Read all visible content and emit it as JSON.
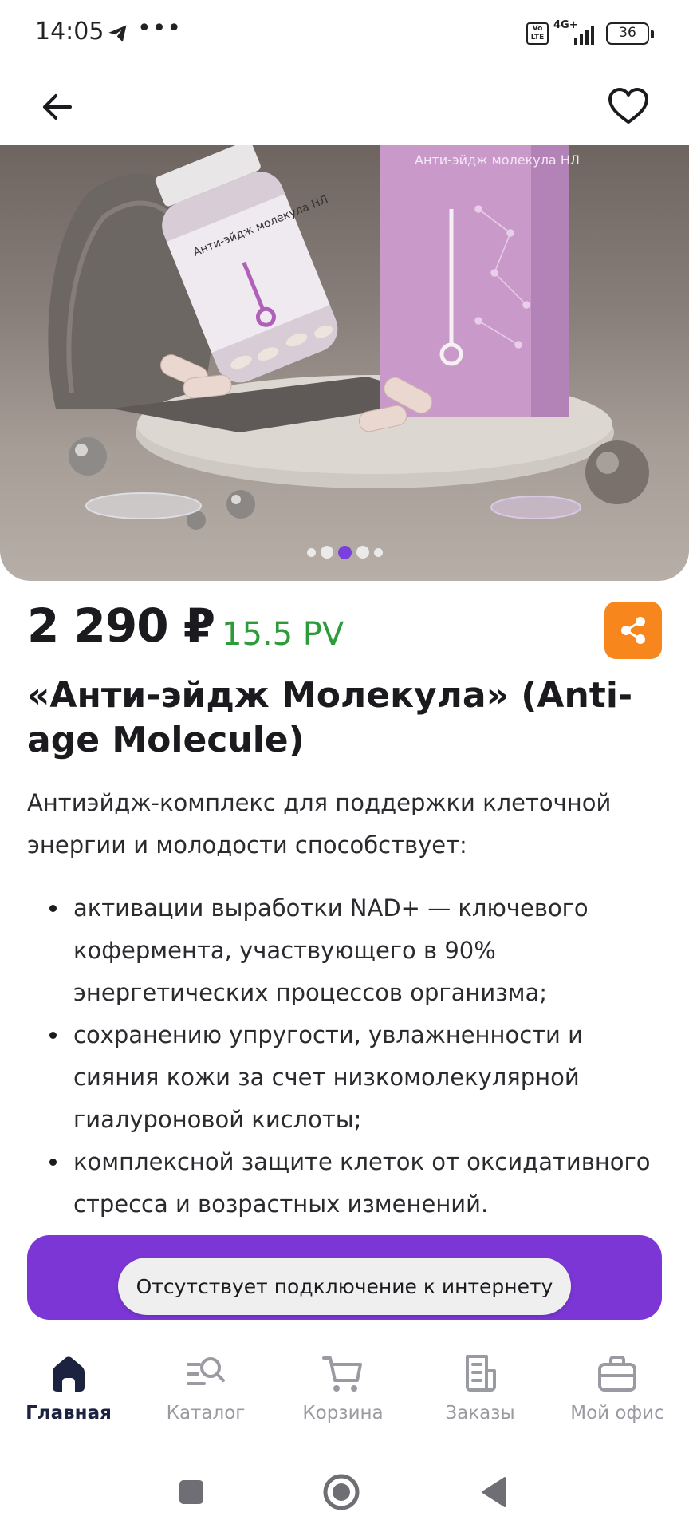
{
  "status_bar": {
    "time": "14:05",
    "more": "•••",
    "network": "4G+",
    "volte": "Vo LTE",
    "battery": "36"
  },
  "product": {
    "price": "2 290 ₽",
    "pv": "15.5 PV",
    "title": "«Анти-эйдж Молекула» (Anti-age Molecule)",
    "description": "Антиэйдж-комплекс для поддержки клеточной энергии и молодости способствует:",
    "benefits": [
      "активации выработки NAD+ — ключевого кофермента, участвующего в 90% энергетических процессов организма;",
      "сохранению упругости, увлажненности и сияния кожи за счет низкомолекулярной гиалуроновой кислоты;",
      "комплексной защите клеток от оксидативного стресса и возрастных изменений."
    ],
    "image": {
      "bottle_label": "Анти-эйдж молекула НЛ",
      "box_label": "Анти-эйдж молекула НЛ"
    },
    "gallery": {
      "slide_count": 5,
      "active_index": 2
    }
  },
  "toast": {
    "message": "Отсутствует подключение к интернету"
  },
  "bottom_nav": {
    "items": [
      {
        "label": "Главная",
        "icon": "home-icon",
        "active": true
      },
      {
        "label": "Каталог",
        "icon": "catalog-search-icon",
        "active": false
      },
      {
        "label": "Корзина",
        "icon": "cart-icon",
        "active": false
      },
      {
        "label": "Заказы",
        "icon": "orders-icon",
        "active": false
      },
      {
        "label": "Мой офис",
        "icon": "briefcase-icon",
        "active": false
      }
    ]
  },
  "colors": {
    "accent_purple": "#7c36d6",
    "pv_green": "#2e9b3a",
    "share_orange": "#f7861d",
    "nav_active": "#1c2340",
    "nav_inactive": "#9a9aa2"
  },
  "system_nav": {
    "icons": [
      "recents-square-icon",
      "home-circle-icon",
      "back-triangle-icon"
    ]
  }
}
